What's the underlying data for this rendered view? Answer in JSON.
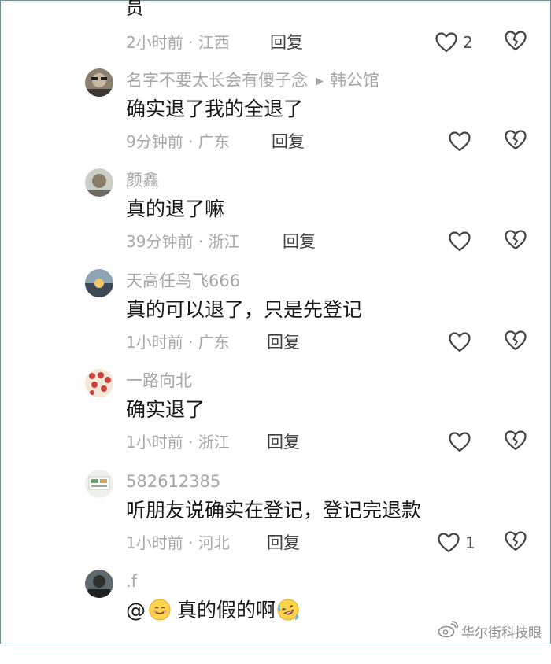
{
  "top_partial": {
    "text_fragment": "员",
    "meta": "2小时前 · 江西",
    "reply_label": "回复",
    "like_count": "2"
  },
  "comments": [
    {
      "username": "名字不要太长会有傻子念",
      "reply_to": "韩公馆",
      "text": "确实退了我的全退了",
      "meta": "9分钟前 · 广东",
      "reply_label": "回复",
      "like_count": ""
    },
    {
      "username": "颜鑫",
      "text": "真的退了嘛",
      "meta": "39分钟前 · 浙江",
      "reply_label": "回复",
      "like_count": ""
    },
    {
      "username": "天高任鸟飞666",
      "text": "真的可以退了，只是先登记",
      "meta": "1小时前 · 广东",
      "reply_label": "回复",
      "like_count": ""
    },
    {
      "username": "一路向北",
      "text": "确实退了",
      "meta": "1小时前 · 浙江",
      "reply_label": "回复",
      "like_count": ""
    },
    {
      "username": "582612385",
      "text": "听朋友说确实在登记，登记完退款",
      "meta": "1小时前 · 河北",
      "reply_label": "回复",
      "like_count": "1"
    },
    {
      "username": ".f",
      "text_prefix": "@",
      "text": "真的假的啊",
      "meta": "",
      "reply_label": "",
      "like_count": ""
    }
  ],
  "watermark": {
    "text": "华尔街科技眼"
  },
  "colors": {
    "text": "#161616",
    "muted": "#a7a7a7",
    "reply": "#404040",
    "icon": "#444444"
  },
  "icons": [
    "heart-outline-icon",
    "broken-heart-icon",
    "weibo-logo-icon",
    "smiling-face-emoji",
    "rofl-emoji"
  ]
}
